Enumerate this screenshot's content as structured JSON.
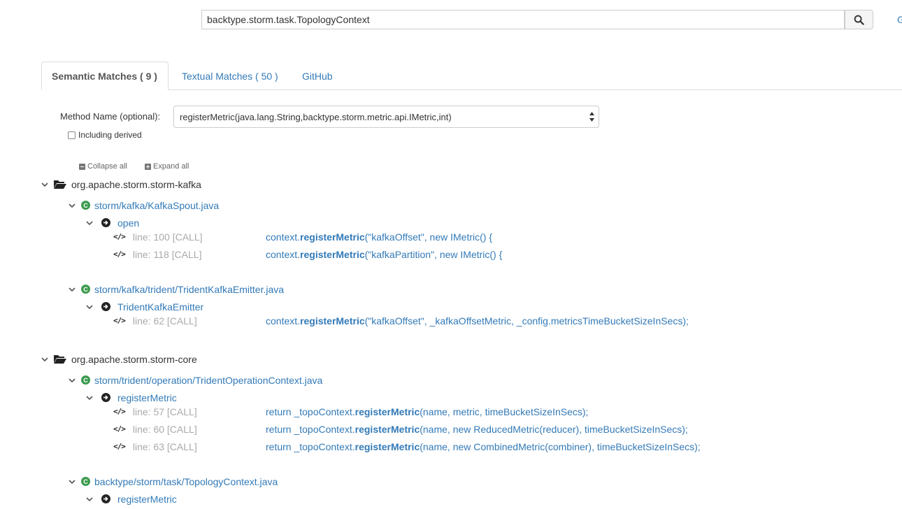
{
  "search": {
    "value": "backtype.storm.task.TopologyContext",
    "edge_link": "G"
  },
  "tabs": [
    {
      "label": "Semantic Matches ( 9 )"
    },
    {
      "label": "Textual Matches ( 50 )"
    },
    {
      "label": "GitHub"
    }
  ],
  "filter": {
    "method_label": "Method Name (optional):",
    "method_value": "registerMetric(java.lang.String,backtype.storm.metric.api.IMetric,int)",
    "derived_label": "Including derived"
  },
  "controls": {
    "collapse_all": "Collapse all",
    "expand_all": "Expand all"
  },
  "tree": {
    "packages": [
      {
        "name": "org.apache.storm.storm-kafka",
        "files": [
          {
            "path": "storm/kafka/KafkaSpout.java",
            "methods": [
              {
                "name": "open",
                "lines": [
                  {
                    "label": "line: 100 [CALL]",
                    "pre": "context.",
                    "hl": "registerMetric",
                    "post": "(\"kafkaOffset\", new IMetric() {"
                  },
                  {
                    "label": "line: 118 [CALL]",
                    "pre": "context.",
                    "hl": "registerMetric",
                    "post": "(\"kafkaPartition\", new IMetric() {"
                  }
                ]
              }
            ]
          },
          {
            "path": "storm/kafka/trident/TridentKafkaEmitter.java",
            "methods": [
              {
                "name": "TridentKafkaEmitter",
                "lines": [
                  {
                    "label": "line: 62 [CALL]",
                    "pre": "context.",
                    "hl": "registerMetric",
                    "post": "(\"kafkaOffset\", _kafkaOffsetMetric, _config.metricsTimeBucketSizeInSecs);"
                  }
                ]
              }
            ]
          }
        ]
      },
      {
        "name": "org.apache.storm.storm-core",
        "files": [
          {
            "path": "storm/trident/operation/TridentOperationContext.java",
            "methods": [
              {
                "name": "registerMetric",
                "lines": [
                  {
                    "label": "line: 57 [CALL]",
                    "pre": "return _topoContext.",
                    "hl": "registerMetric",
                    "post": "(name, metric, timeBucketSizeInSecs);"
                  },
                  {
                    "label": "line: 60 [CALL]",
                    "pre": "return _topoContext.",
                    "hl": "registerMetric",
                    "post": "(name, new ReducedMetric(reducer), timeBucketSizeInSecs);"
                  },
                  {
                    "label": "line: 63 [CALL]",
                    "pre": "return _topoContext.",
                    "hl": "registerMetric",
                    "post": "(name, new CombinedMetric(combiner), timeBucketSizeInSecs);"
                  }
                ]
              }
            ]
          },
          {
            "path": "backtype/storm/task/TopologyContext.java",
            "methods": [
              {
                "name": "registerMetric",
                "lines": []
              }
            ]
          }
        ]
      }
    ]
  },
  "colors": {
    "link": "#337ab7",
    "file_icon": "#3c9a4e",
    "muted": "#aaaaaa"
  },
  "icons": [
    "search-icon",
    "folder-open-icon",
    "class-icon",
    "method-arrow-icon",
    "code-icon",
    "chevron-down-icon"
  ]
}
